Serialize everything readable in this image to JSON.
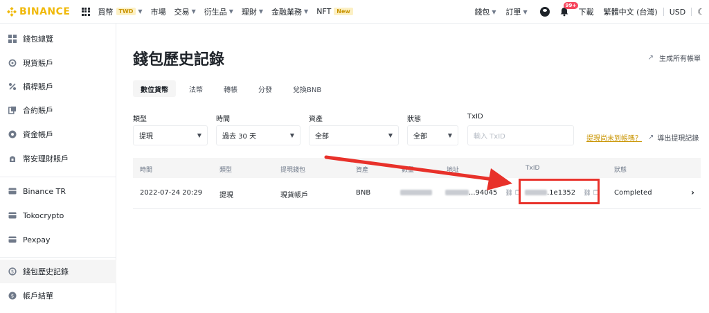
{
  "topnav": {
    "logo_text": "BINANCE",
    "items": [
      {
        "label": "買幣",
        "badge": "TWD",
        "caret": true
      },
      {
        "label": "市場",
        "caret": false
      },
      {
        "label": "交易",
        "caret": true
      },
      {
        "label": "衍生品",
        "caret": true
      },
      {
        "label": "理財",
        "caret": true
      },
      {
        "label": "金融業務",
        "caret": true
      },
      {
        "label": "NFT",
        "badge": "New",
        "caret": false
      }
    ],
    "right": {
      "wallet": "錢包",
      "orders": "訂單",
      "notifications_count": "99+",
      "download": "下載",
      "language": "繁體中文 (台灣)",
      "currency": "USD"
    }
  },
  "sidebar": {
    "items": [
      {
        "label": "錢包總覽",
        "icon": "dashboard-icon"
      },
      {
        "label": "現貨賬戶",
        "icon": "spot-icon"
      },
      {
        "label": "槓桿賬戶",
        "icon": "margin-percent-icon"
      },
      {
        "label": "合約賬戶",
        "icon": "futures-icon"
      },
      {
        "label": "資金帳戶",
        "icon": "funding-icon"
      },
      {
        "label": "幣安理財賬戶",
        "icon": "earn-icon"
      },
      {
        "label": "Binance TR",
        "icon": "wallet-icon"
      },
      {
        "label": "Tokocrypto",
        "icon": "wallet-icon"
      },
      {
        "label": "Pexpay",
        "icon": "wallet-icon"
      },
      {
        "label": "錢包歷史記錄",
        "icon": "history-icon",
        "active": true
      },
      {
        "label": "帳戶結單",
        "icon": "statement-icon"
      }
    ]
  },
  "main": {
    "title": "錢包歷史記錄",
    "generate_statement": "生成所有帳單",
    "tabs": [
      "數位貨幣",
      "法幣",
      "轉帳",
      "分發",
      "兌換BNB"
    ],
    "filters": {
      "type": {
        "label": "類型",
        "value": "提現"
      },
      "time": {
        "label": "時間",
        "value": "過去 30 天"
      },
      "asset": {
        "label": "資產",
        "value": "全部"
      },
      "status": {
        "label": "狀態",
        "value": "全部"
      },
      "txid": {
        "label": "TxID",
        "placeholder": "輸入 TxID"
      }
    },
    "not_received_link": "提現尚未到帳嗎？",
    "export_link": "導出提現記錄",
    "table": {
      "headers": [
        "時間",
        "類型",
        "提現錢包",
        "資產",
        "數量",
        "地址",
        "TxID",
        "狀態"
      ],
      "rows": [
        {
          "time": "2022-07-24 20:29",
          "type": "提現",
          "wallet": "現貨帳戶",
          "asset": "BNB",
          "address_suffix": "...94045",
          "txid_suffix": ".1e1352",
          "status": "Completed"
        }
      ]
    }
  },
  "colors": {
    "brand": "#f0b90b",
    "annotation_red": "#e8312a",
    "link_gold": "#c99400"
  }
}
